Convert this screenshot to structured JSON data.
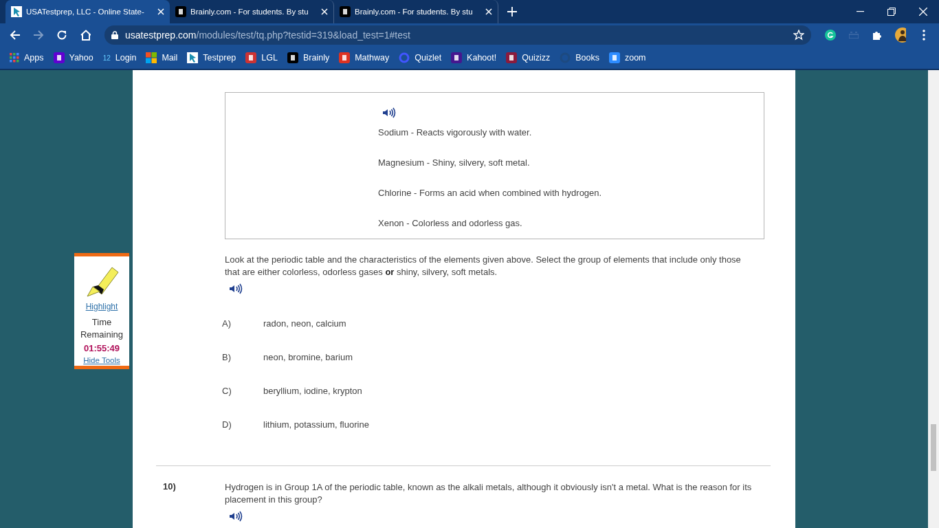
{
  "browser": {
    "tabs": [
      {
        "title": "USATestprep, LLC - Online State-",
        "selected": true
      },
      {
        "title": "Brainly.com - For students. By stu",
        "selected": false
      },
      {
        "title": "Brainly.com - For students. By stu",
        "selected": false
      }
    ],
    "address": {
      "host": "usatestprep.com",
      "path": "/modules/test/tq.php?testid=319&load_test=1#test"
    },
    "bookmarks": [
      {
        "label": "Apps"
      },
      {
        "label": "Yahoo"
      },
      {
        "label": "Login",
        "glyph": "12"
      },
      {
        "label": "Mail"
      },
      {
        "label": "Testprep"
      },
      {
        "label": "LGL"
      },
      {
        "label": "Brainly"
      },
      {
        "label": "Mathway"
      },
      {
        "label": "Quizlet"
      },
      {
        "label": "Kahoot!"
      },
      {
        "label": "Quizizz"
      },
      {
        "label": "Books"
      },
      {
        "label": "zoom"
      }
    ]
  },
  "tools": {
    "highlight": "Highlight",
    "time_label": "Time Remaining",
    "timer": "01:55:49",
    "hide": "Hide Tools"
  },
  "info_box": {
    "items": [
      "Sodium - Reacts vigorously with water.",
      "Magnesium - Shiny, silvery, soft metal.",
      "Chlorine - Forms an acid when combined with hydrogen.",
      "Xenon - Colorless and odorless gas."
    ]
  },
  "question": {
    "text": "Look at the periodic table and the characteristics of the elements given above. Select the group of elements that include only those that are either colorless, odorless gases **or** shiny, silvery, soft metals.",
    "options": [
      {
        "letter": "A)",
        "text": "radon, neon, calcium"
      },
      {
        "letter": "B)",
        "text": "neon, bromine, barium"
      },
      {
        "letter": "C)",
        "text": "beryllium, iodine, krypton"
      },
      {
        "letter": "D)",
        "text": "lithium, potassium, fluorine"
      }
    ]
  },
  "next_question": {
    "number": "10)",
    "text": "Hydrogen is in Group 1A of the periodic table, known as the alkali metals, although it obviously isn't a metal. What is the reason for its placement in this group?"
  }
}
